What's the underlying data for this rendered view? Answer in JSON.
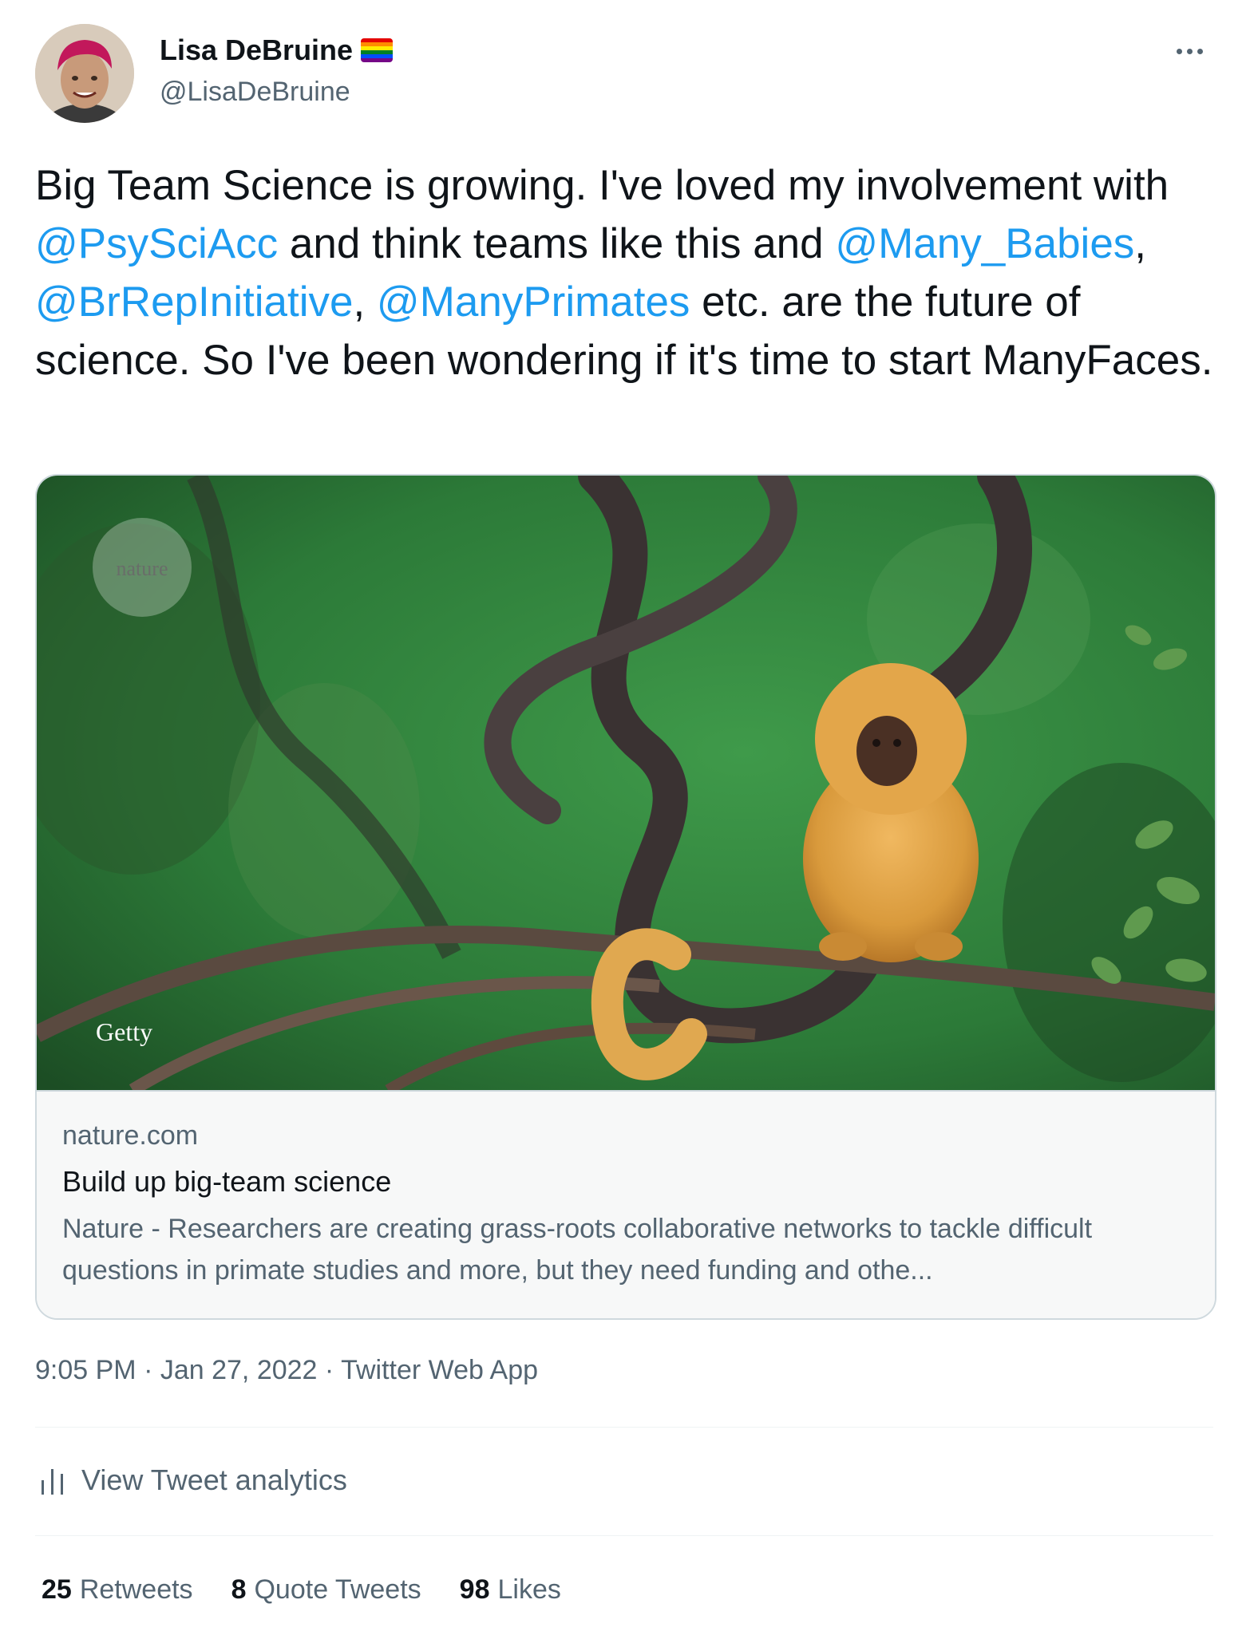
{
  "author": {
    "display_name": "Lisa DeBruine",
    "handle": "@LisaDeBruine",
    "flag_icon": "rainbow-flag-icon"
  },
  "tweet": {
    "text_parts": [
      {
        "type": "text",
        "value": "Big Team Science is growing. I've loved my involvement with "
      },
      {
        "type": "mention",
        "value": "@PsySciAcc"
      },
      {
        "type": "text",
        "value": " and think teams like this and "
      },
      {
        "type": "mention",
        "value": "@Many_Babies"
      },
      {
        "type": "text",
        "value": ", "
      },
      {
        "type": "mention",
        "value": "@BrRepInitiative"
      },
      {
        "type": "text",
        "value": ", "
      },
      {
        "type": "mention",
        "value": "@ManyPrimates"
      },
      {
        "type": "text",
        "value": " etc. are the future of science. So I've been wondering if it's time to start ManyFaces."
      }
    ]
  },
  "card": {
    "image_watermark": "nature",
    "image_credit": "Getty",
    "domain": "nature.com",
    "title": "Build up big-team science",
    "description": "Nature - Researchers are creating grass-roots collaborative networks to tackle difficult questions in primate studies and more, but they need funding and othe..."
  },
  "meta": {
    "time": "9:05 PM",
    "separator": " · ",
    "date": "Jan 27, 2022",
    "source": "Twitter Web App"
  },
  "analytics": {
    "label": "View Tweet analytics",
    "icon": "bar-chart-icon"
  },
  "stats": {
    "retweets_count": "25",
    "retweets_label": "Retweets",
    "quotes_count": "8",
    "quotes_label": "Quote Tweets",
    "likes_count": "98",
    "likes_label": "Likes"
  },
  "colors": {
    "mention": "#1d9bf0",
    "secondary_text": "#536471",
    "primary_text": "#0f1419",
    "card_border": "#cfd9de"
  }
}
